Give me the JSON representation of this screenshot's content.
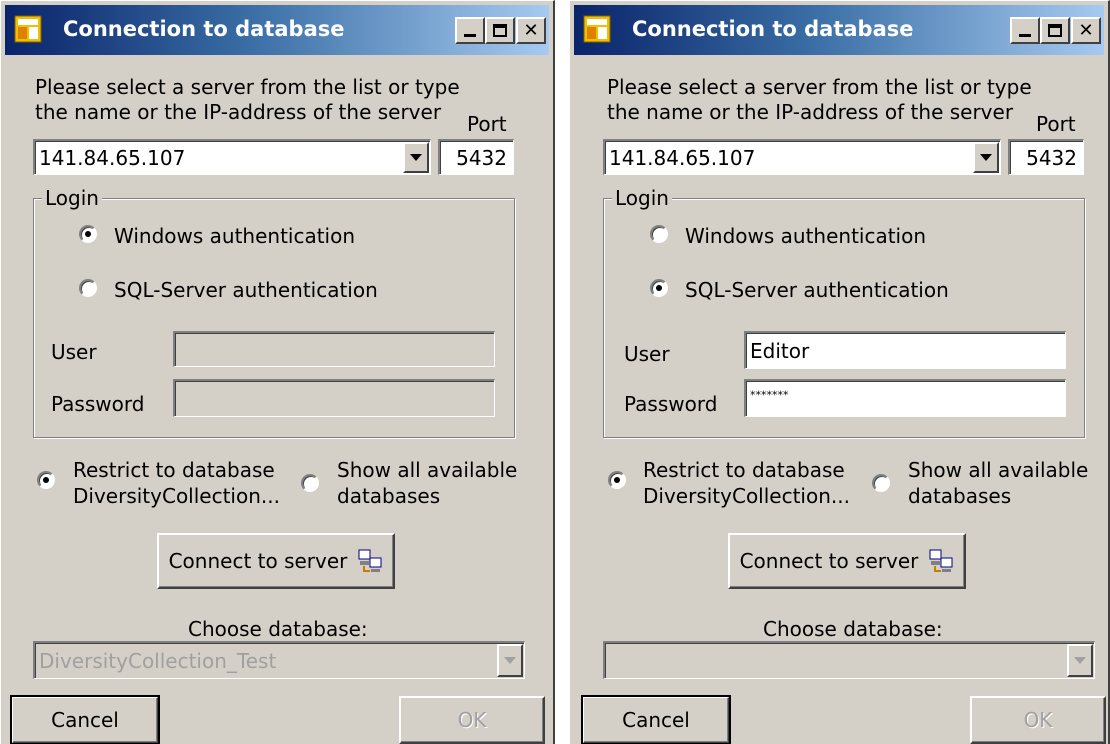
{
  "dialogs": [
    {
      "title": "Connection to database",
      "intro_line1": "Please select a server from the list or type",
      "intro_line2": "the name or the IP-address of the server",
      "port_label": "Port",
      "server": "141.84.65.107",
      "port": "5432",
      "login_group": "Login",
      "windows_auth": "Windows authentication",
      "sql_auth": "SQL-Server authentication",
      "selected_auth": "windows",
      "user_label": "User",
      "password_label": "Password",
      "user": "",
      "password": "",
      "credentials_enabled": false,
      "restrict_line1": "Restrict to database",
      "restrict_line2": "DiversityCollection...",
      "showall_line1": "Show all available",
      "showall_line2": "databases",
      "selected_scope": "restrict",
      "connect_button": "Connect to server",
      "choose_db_label": "Choose database:",
      "database": "DiversityCollection_Test",
      "cancel_button": "Cancel",
      "ok_button": "OK"
    },
    {
      "title": "Connection to database",
      "intro_line1": "Please select a server from the list or type",
      "intro_line2": "the name or the IP-address of the server",
      "port_label": "Port",
      "server": "141.84.65.107",
      "port": "5432",
      "login_group": "Login",
      "windows_auth": "Windows authentication",
      "sql_auth": "SQL-Server authentication",
      "selected_auth": "sql",
      "user_label": "User",
      "password_label": "Password",
      "user": "Editor",
      "password": "*******",
      "credentials_enabled": true,
      "restrict_line1": "Restrict to database",
      "restrict_line2": "DiversityCollection...",
      "showall_line1": "Show all available",
      "showall_line2": "databases",
      "selected_scope": "restrict",
      "connect_button": "Connect to server",
      "choose_db_label": "Choose database:",
      "database": "",
      "cancel_button": "Cancel",
      "ok_button": "OK"
    }
  ],
  "icons": {
    "app": "database-window-icon",
    "minimize": "minimize-icon",
    "maximize": "maximize-icon",
    "close": "close-icon",
    "connect": "network-computers-icon",
    "dropdown": "chevron-down-icon"
  },
  "colors": {
    "title_start": "#0a246a",
    "title_end": "#a6caf0",
    "face": "#d4d0c8",
    "disabled_text": "#a0a0a0"
  }
}
